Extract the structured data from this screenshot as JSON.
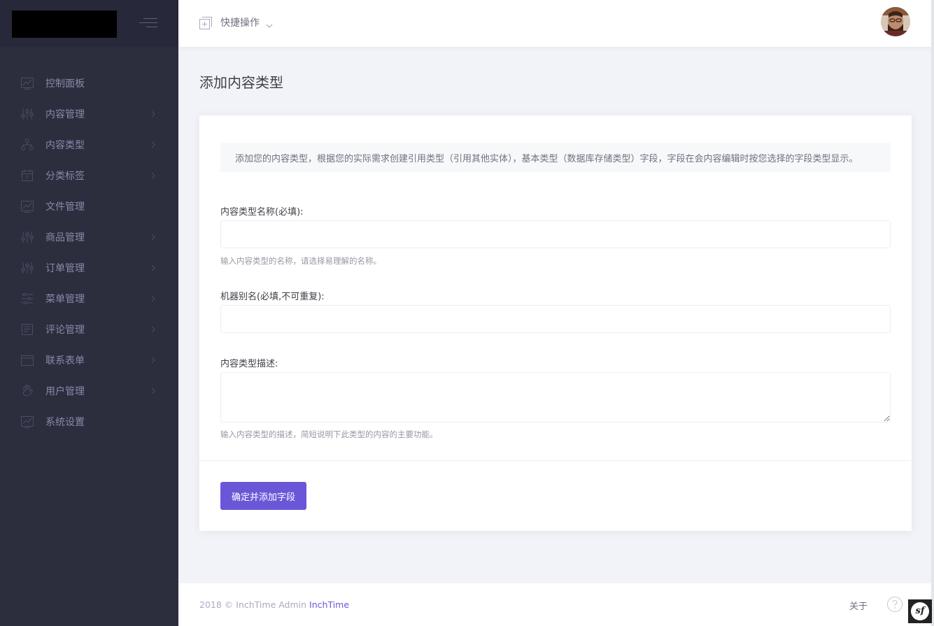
{
  "sidebar": {
    "items": [
      {
        "label": "控制面板",
        "icon": "chart-icon",
        "has_arrow": false
      },
      {
        "label": "内容管理",
        "icon": "sliders-icon",
        "has_arrow": true
      },
      {
        "label": "内容类型",
        "icon": "tree-icon",
        "has_arrow": true
      },
      {
        "label": "分类标签",
        "icon": "calendar-icon",
        "has_arrow": true
      },
      {
        "label": "文件管理",
        "icon": "chart-icon",
        "has_arrow": false
      },
      {
        "label": "商品管理",
        "icon": "sliders-icon",
        "has_arrow": true
      },
      {
        "label": "订单管理",
        "icon": "sliders-icon",
        "has_arrow": true
      },
      {
        "label": "菜单管理",
        "icon": "settings-lines-icon",
        "has_arrow": true
      },
      {
        "label": "评论管理",
        "icon": "board-icon",
        "has_arrow": true
      },
      {
        "label": "联系表单",
        "icon": "window-icon",
        "has_arrow": true
      },
      {
        "label": "用户管理",
        "icon": "hand-icon",
        "has_arrow": true
      },
      {
        "label": "系统设置",
        "icon": "chart-icon",
        "has_arrow": false
      }
    ]
  },
  "header": {
    "quick_actions_label": "快捷操作"
  },
  "page": {
    "title": "添加内容类型"
  },
  "form": {
    "notice": "添加您的内容类型，根据您的实际需求创建引用类型（引用其他实体），基本类型（数据库存储类型）字段，字段在会内容编辑时按您选择的字段类型显示。",
    "name_label": "内容类型名称(必填):",
    "name_value": "",
    "name_help": "输入内容类型的名称，请选择易理解的名称。",
    "alias_label": "机器别名(必填,不可重复):",
    "alias_value": "",
    "desc_label": "内容类型描述:",
    "desc_value": "",
    "desc_help": "输入内容类型的描述，简短说明下此类型的内容的主要功能。",
    "submit_label": "确定并添加字段"
  },
  "footer": {
    "copyright": "2018 © InchTime Admin ",
    "brand": "InchTime",
    "about": "关于"
  },
  "badge": {
    "label": "sf"
  },
  "colors": {
    "sidebar_bg": "#2c2e3e",
    "accent": "#6a57d8",
    "page_bg": "#f2f3f8"
  }
}
